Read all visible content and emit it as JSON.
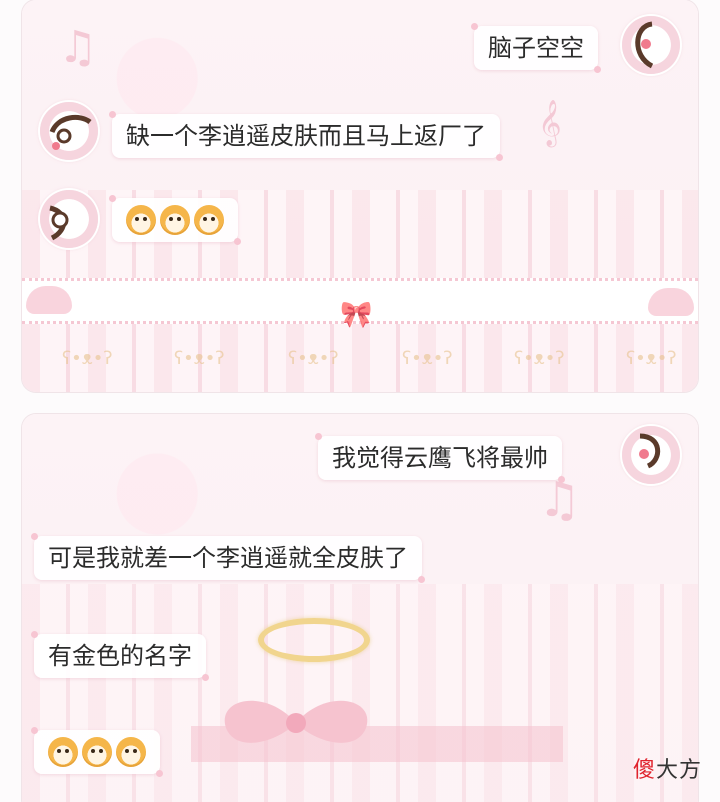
{
  "top_panel": {
    "messages": [
      {
        "side": "right",
        "text": "脑子空空"
      },
      {
        "side": "left",
        "text": "缺一个李逍遥皮肤而且马上返厂了"
      },
      {
        "side": "left",
        "emoji": [
          "shiba-emoji",
          "shiba-emoji",
          "shiba-emoji"
        ]
      }
    ]
  },
  "bottom_panel": {
    "messages": [
      {
        "side": "right",
        "text": "我觉得云鹰飞将最帅"
      },
      {
        "side": "left",
        "text": "可是我就差一个李逍遥就全皮肤了"
      },
      {
        "side": "left",
        "text": "有金色的名字"
      },
      {
        "side": "left",
        "emoji": [
          "shiba-emoji",
          "shiba-emoji",
          "shiba-emoji"
        ]
      }
    ]
  },
  "watermark": {
    "first": "傻",
    "rest": "大方"
  },
  "colors": {
    "bubble_bg": "#ffffff",
    "accent_pink": "#f7c5d2",
    "halo_gold": "#f1d58e",
    "watermark_red": "#e0232d"
  }
}
